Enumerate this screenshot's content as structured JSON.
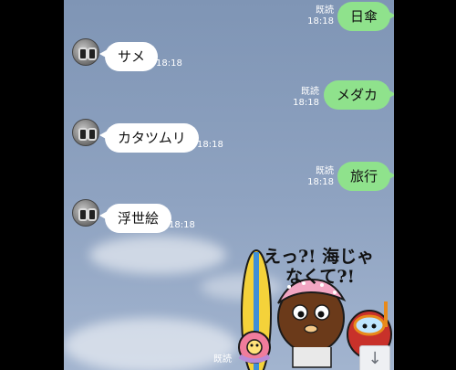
{
  "messages": [
    {
      "side": "out",
      "text": "日傘",
      "read": "既読",
      "time": "18:18"
    },
    {
      "side": "in",
      "text": "サメ",
      "time": "18:18"
    },
    {
      "side": "out",
      "text": "メダカ",
      "read": "既読",
      "time": "18:18"
    },
    {
      "side": "in",
      "text": "カタツムリ",
      "time": "18:18"
    },
    {
      "side": "out",
      "text": "旅行",
      "read": "既読",
      "time": "18:18"
    },
    {
      "side": "in",
      "text": "浮世絵",
      "time": "18:18"
    }
  ],
  "sticker": {
    "line1": "えっ?! 海じゃ",
    "line2": "なくて?!",
    "read": "既読",
    "description": "sticker-brown-character-with-surfboard"
  },
  "scroll_button": {
    "icon": "arrow-down-icon",
    "glyph": "↓"
  },
  "colors": {
    "outgoing_bubble": "#8fe28c",
    "incoming_bubble": "#ffffff",
    "background": "#8fa3c1"
  }
}
